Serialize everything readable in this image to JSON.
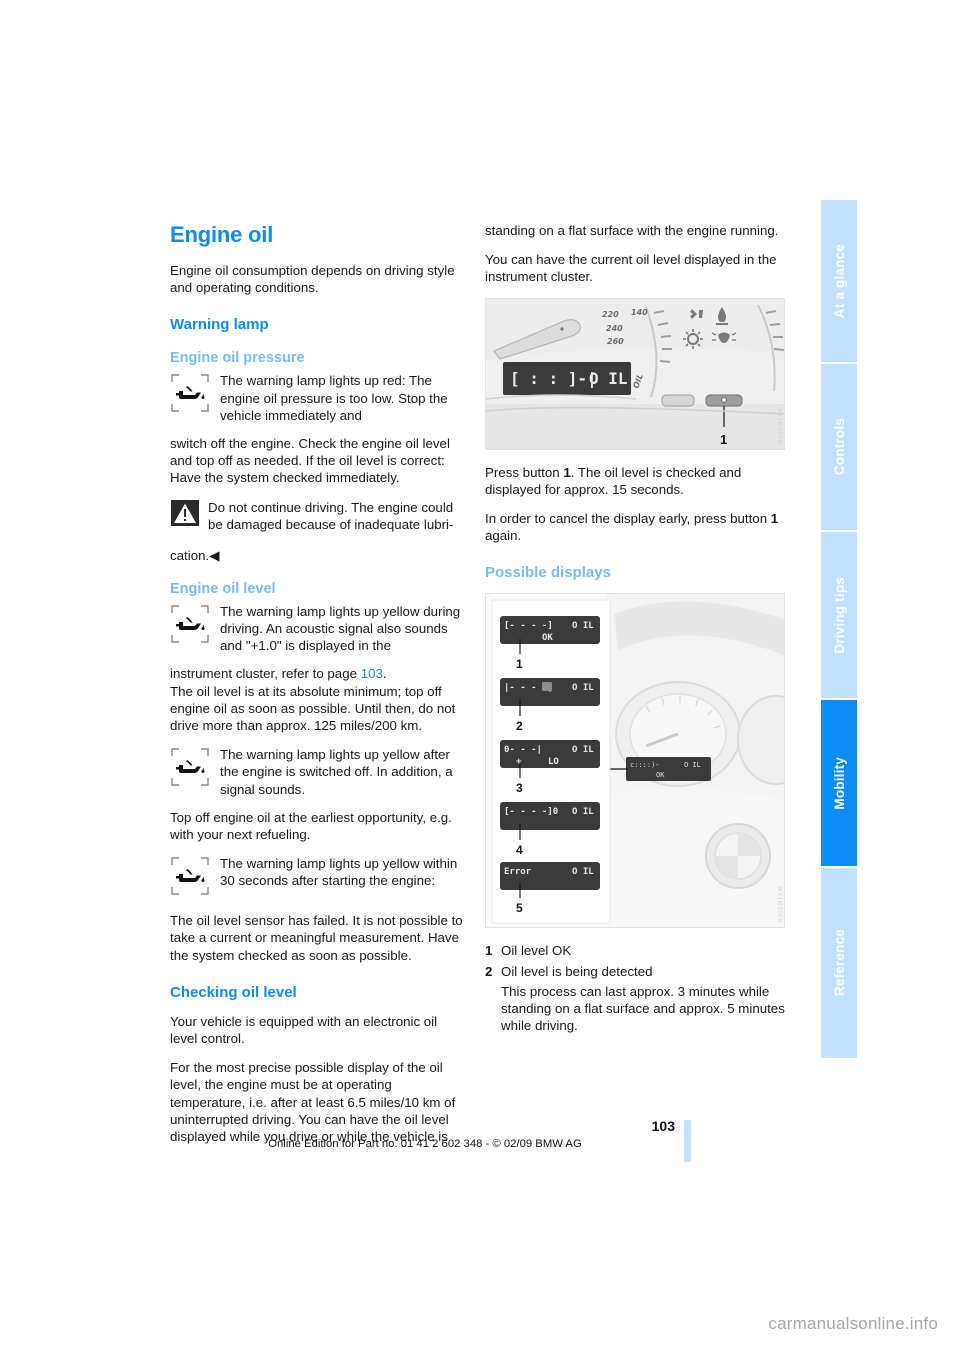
{
  "document": {
    "page_number": "103",
    "footer_line": "Online Edition for Part no. 01 41 2 602 348 - © 02/09 BMW AG",
    "watermark": "carmanualsonline.info"
  },
  "tab_rail": {
    "tabs": [
      {
        "label": "At a glance",
        "active": false
      },
      {
        "label": "Controls",
        "active": false
      },
      {
        "label": "Driving tips",
        "active": false
      },
      {
        "label": "Mobility",
        "active": true
      },
      {
        "label": "Reference",
        "active": false
      }
    ],
    "active_color": "#0d8bf7",
    "inactive_color": "#c2e0ff"
  },
  "colors": {
    "heading_blue": "#0d8bf7",
    "subheading_light_blue": "#74bdf7",
    "link_blue": "#2a82dd",
    "body_text": "#1a1a1a"
  },
  "left_column": {
    "section_title": "Engine oil",
    "intro": "Engine oil consumption depends on driving style and operating conditions.",
    "warning_lamp_heading": "Warning lamp",
    "oil_pressure": {
      "heading": "Engine oil pressure",
      "lamp_text": "The warning lamp lights up red: The engine oil pressure is too low. Stop the vehicle immediately and",
      "continuation": "switch off the engine. Check the engine oil level and top off as needed. If the oil level is correct: Have the system checked immediately.",
      "warning_text": "Do not continue driving. The engine could be damaged because of inadequate lubri-",
      "warning_tail": "cation.◀"
    },
    "oil_level": {
      "heading": "Engine oil level",
      "case1_lamp_text": "The warning lamp lights up yellow during driving. An acoustic signal also sounds and \"+1.0\" is displayed in the",
      "case1_cont_pre": "instrument cluster, refer to page ",
      "case1_cont_link": "103",
      "case1_cont_post": ".",
      "case1_cont2": "The oil level is at its absolute minimum; top off engine oil as soon as possible. Until then, do not drive more than approx. 125 miles/200 km.",
      "case2_lamp_text": "The warning lamp lights up yellow after the engine is switched off. In addition, a signal sounds.",
      "case2_cont": "Top off engine oil at the earliest opportunity, e.g. with your next refueling.",
      "case3_lamp_text": "The warning lamp lights up yellow within 30 seconds after starting the engine:",
      "case3_cont": "The oil level sensor has failed. It is not possible to take a current or meaningful measurement. Have the system checked as soon as possible."
    },
    "checking_oil_level": {
      "heading": "Checking oil level",
      "para1": "Your vehicle is equipped with an electronic oil level control.",
      "para2": "For the most precise possible display of the oil level, the engine must be at operating temperature, i.e. after at least 6.5 miles/10 km of uninterrupted driving. You can have the oil level displayed while you drive or while the vehicle is"
    }
  },
  "right_column": {
    "cont_para1": "standing on a flat surface with the engine running.",
    "cont_para2": "You can have the current oil level displayed in the instrument cluster.",
    "figure_cluster": {
      "caption_number": "1",
      "lcd_left": "[ : : ]-|",
      "lcd_right": "O IL",
      "gauge_labels": [
        "220",
        "140",
        "240",
        "260"
      ],
      "code": "WX1MS0PK"
    },
    "press_button_pre": "Press button ",
    "press_button_bold": "1",
    "press_button_post": ". The oil level is checked and displayed for approx. 15 seconds.",
    "cancel_pre": "In order to cancel the display early, press button ",
    "cancel_bold": "1",
    "cancel_post": " again.",
    "possible_displays_heading": "Possible displays",
    "figure_displays": {
      "code": "WX1MS0PK",
      "cluster_lcd_left": "c::::)-",
      "cluster_lcd_right": "O IL",
      "cluster_lcd_mid": "OK",
      "items": [
        {
          "num": "1",
          "left": "[----]",
          "right": "O IL",
          "mid": "OK"
        },
        {
          "num": "2",
          "left": "|----|",
          "right": "O IL",
          "mid": ""
        },
        {
          "num": "3",
          "left": "0---|",
          "right": "O IL",
          "mid": "LO",
          "plus": "+"
        },
        {
          "num": "4",
          "left": "[----]0",
          "right": "O IL",
          "mid": ""
        },
        {
          "num": "5",
          "left": "Error",
          "right": "O IL",
          "mid": ""
        }
      ]
    },
    "legend": [
      {
        "num": "1",
        "label": "Oil level OK",
        "detail": ""
      },
      {
        "num": "2",
        "label": "Oil level is being detected",
        "detail": "This process can last approx. 3 minutes while standing on a flat surface and approx. 5 minutes while driving."
      }
    ]
  }
}
